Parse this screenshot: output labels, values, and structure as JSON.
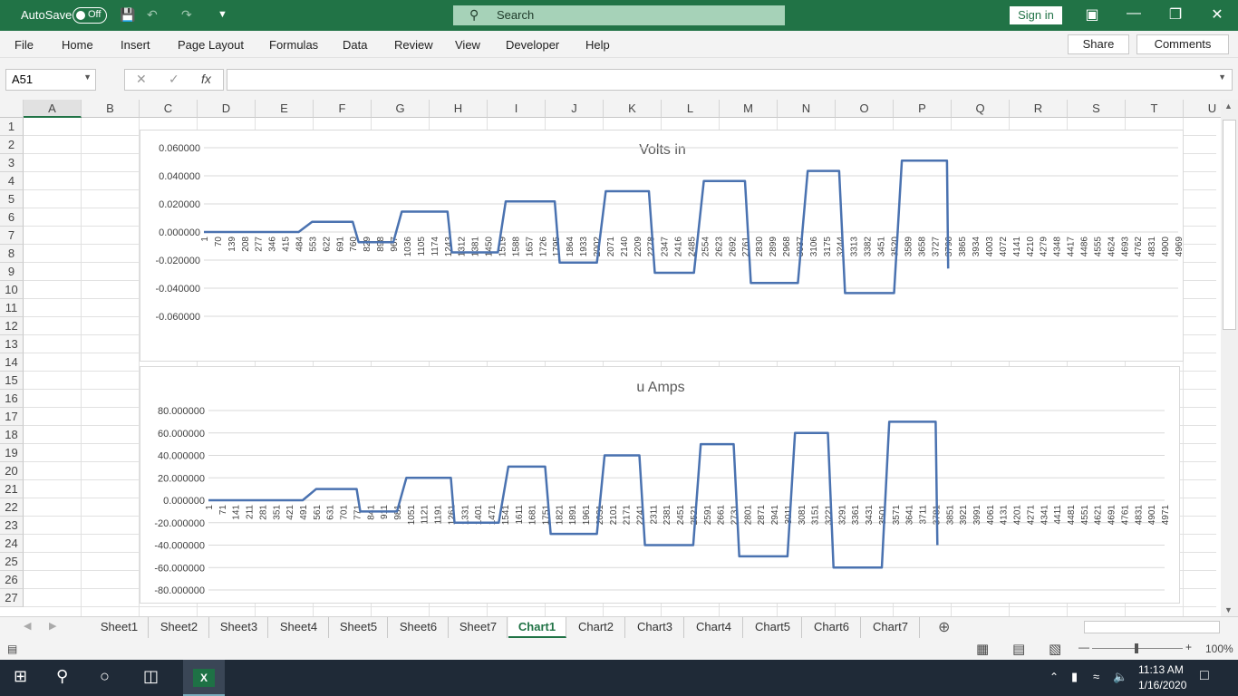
{
  "titlebar": {
    "autosave": "AutoSave",
    "toggle": "Off",
    "search": "Search",
    "signin": "Sign in"
  },
  "ribbon": {
    "tabs": [
      "File",
      "Home",
      "Insert",
      "Page Layout",
      "Formulas",
      "Data",
      "Review",
      "View",
      "Developer",
      "Help"
    ],
    "share": "Share",
    "comments": "Comments"
  },
  "formula_bar": {
    "namebox": "A51",
    "fx": "fx",
    "value": ""
  },
  "columns": [
    "A",
    "B",
    "C",
    "D",
    "E",
    "F",
    "G",
    "H",
    "I",
    "J",
    "K",
    "L",
    "M",
    "N",
    "O",
    "P",
    "Q",
    "R",
    "S",
    "T",
    "U"
  ],
  "rows": [
    "1",
    "2",
    "3",
    "4",
    "5",
    "6",
    "7",
    "8",
    "9",
    "10",
    "11",
    "12",
    "13",
    "14",
    "15",
    "16",
    "17",
    "18",
    "19",
    "20",
    "21",
    "22",
    "23",
    "24",
    "25",
    "26",
    "27"
  ],
  "sheet_tabs": [
    "Sheet1",
    "Sheet2",
    "Sheet3",
    "Sheet4",
    "Sheet5",
    "Sheet6",
    "Sheet7",
    "Chart1",
    "Chart2",
    "Chart3",
    "Chart4",
    "Chart5",
    "Chart6",
    "Chart7"
  ],
  "active_sheet": "Chart1",
  "status": {
    "zoom": "100%"
  },
  "taskbar": {
    "time": "11:13 AM",
    "date": "1/16/2020"
  },
  "chart_data": [
    {
      "type": "line",
      "title": "Volts in",
      "xlabel": "",
      "ylabel": "",
      "ylim": [
        -0.06,
        0.06
      ],
      "yticks": [
        "0.060000",
        "0.040000",
        "0.020000",
        "0.000000",
        "-0.020000",
        "-0.040000",
        "-0.060000"
      ],
      "xticks": [
        "1",
        "70",
        "139",
        "208",
        "277",
        "346",
        "415",
        "484",
        "553",
        "622",
        "691",
        "760",
        "829",
        "898",
        "967",
        "1036",
        "1105",
        "1174",
        "1243",
        "1312",
        "1381",
        "1450",
        "1519",
        "1588",
        "1657",
        "1726",
        "1795",
        "1864",
        "1933",
        "2002",
        "2071",
        "2140",
        "2209",
        "2278",
        "2347",
        "2416",
        "2485",
        "2554",
        "2623",
        "2692",
        "2761",
        "2830",
        "2899",
        "2968",
        "3037",
        "3106",
        "3175",
        "3244",
        "3313",
        "3382",
        "3451",
        "3520",
        "3589",
        "3658",
        "3727",
        "3796",
        "3865",
        "3934",
        "4003",
        "4072",
        "4141",
        "4210",
        "4279",
        "4348",
        "4417",
        "4486",
        "4555",
        "4624",
        "4693",
        "4762",
        "4831",
        "4900",
        "4969"
      ],
      "color": "#4a72b0",
      "levels": [
        {
          "x": 1,
          "y": 0.0
        },
        {
          "x": 484,
          "y": 0.0
        },
        {
          "x": 553,
          "y": 0.0072
        },
        {
          "x": 760,
          "y": 0.0072
        },
        {
          "x": 790,
          "y": -0.0072
        },
        {
          "x": 967,
          "y": -0.0072
        },
        {
          "x": 1010,
          "y": 0.0145
        },
        {
          "x": 1243,
          "y": 0.0145
        },
        {
          "x": 1265,
          "y": -0.0145
        },
        {
          "x": 1500,
          "y": -0.0145
        },
        {
          "x": 1540,
          "y": 0.0218
        },
        {
          "x": 1790,
          "y": 0.0218
        },
        {
          "x": 1815,
          "y": -0.0218
        },
        {
          "x": 2005,
          "y": -0.0218
        },
        {
          "x": 2050,
          "y": 0.029
        },
        {
          "x": 2270,
          "y": 0.029
        },
        {
          "x": 2300,
          "y": -0.029
        },
        {
          "x": 2500,
          "y": -0.029
        },
        {
          "x": 2550,
          "y": 0.0363
        },
        {
          "x": 2760,
          "y": 0.0363
        },
        {
          "x": 2790,
          "y": -0.0363
        },
        {
          "x": 3030,
          "y": -0.0363
        },
        {
          "x": 3080,
          "y": 0.0435
        },
        {
          "x": 3240,
          "y": 0.0435
        },
        {
          "x": 3270,
          "y": -0.0435
        },
        {
          "x": 3520,
          "y": -0.0435
        },
        {
          "x": 3560,
          "y": 0.0508
        },
        {
          "x": 3790,
          "y": 0.0508
        },
        {
          "x": 3796,
          "y": -0.026
        }
      ]
    },
    {
      "type": "line",
      "title": "u Amps",
      "xlabel": "",
      "ylabel": "",
      "ylim": [
        -80,
        80
      ],
      "yticks": [
        "80.000000",
        "60.000000",
        "40.000000",
        "20.000000",
        "0.000000",
        "-20.000000",
        "-40.000000",
        "-60.000000",
        "-80.000000"
      ],
      "xticks": [
        "1",
        "71",
        "141",
        "211",
        "281",
        "351",
        "421",
        "491",
        "561",
        "631",
        "701",
        "771",
        "841",
        "911",
        "981",
        "1051",
        "1121",
        "1191",
        "1261",
        "1331",
        "1401",
        "1471",
        "1541",
        "1611",
        "1681",
        "1751",
        "1821",
        "1891",
        "1961",
        "2031",
        "2101",
        "2171",
        "2241",
        "2311",
        "2381",
        "2451",
        "2521",
        "2591",
        "2661",
        "2731",
        "2801",
        "2871",
        "2941",
        "3011",
        "3081",
        "3151",
        "3221",
        "3291",
        "3361",
        "3431",
        "3501",
        "3571",
        "3641",
        "3711",
        "3781",
        "3851",
        "3921",
        "3991",
        "4061",
        "4131",
        "4201",
        "4271",
        "4341",
        "4411",
        "4481",
        "4551",
        "4621",
        "4691",
        "4761",
        "4831",
        "4901",
        "4971"
      ],
      "color": "#4a72b0",
      "levels": [
        {
          "x": 1,
          "y": 0
        },
        {
          "x": 491,
          "y": 0
        },
        {
          "x": 561,
          "y": 10
        },
        {
          "x": 771,
          "y": 10
        },
        {
          "x": 790,
          "y": -10
        },
        {
          "x": 981,
          "y": -10
        },
        {
          "x": 1030,
          "y": 20
        },
        {
          "x": 1261,
          "y": 20
        },
        {
          "x": 1280,
          "y": -20
        },
        {
          "x": 1510,
          "y": -20
        },
        {
          "x": 1560,
          "y": 30
        },
        {
          "x": 1751,
          "y": 30
        },
        {
          "x": 1780,
          "y": -30
        },
        {
          "x": 2020,
          "y": -30
        },
        {
          "x": 2060,
          "y": 40
        },
        {
          "x": 2241,
          "y": 40
        },
        {
          "x": 2270,
          "y": -40
        },
        {
          "x": 2521,
          "y": -40
        },
        {
          "x": 2560,
          "y": 50
        },
        {
          "x": 2731,
          "y": 50
        },
        {
          "x": 2760,
          "y": -50
        },
        {
          "x": 3011,
          "y": -50
        },
        {
          "x": 3050,
          "y": 60
        },
        {
          "x": 3221,
          "y": 60
        },
        {
          "x": 3250,
          "y": -60
        },
        {
          "x": 3501,
          "y": -60
        },
        {
          "x": 3540,
          "y": 70
        },
        {
          "x": 3781,
          "y": 70
        },
        {
          "x": 3790,
          "y": -40
        }
      ]
    }
  ]
}
